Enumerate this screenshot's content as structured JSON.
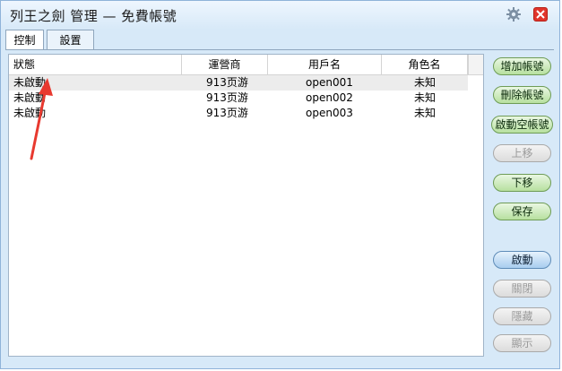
{
  "window": {
    "title": "列王之劍 管理 — 免費帳號"
  },
  "icons": {
    "settings": "gear-icon",
    "close": "close-icon"
  },
  "tabs": [
    {
      "label": "控制"
    },
    {
      "label": "設置"
    }
  ],
  "table": {
    "columns": [
      "狀態",
      "運營商",
      "用戶名",
      "角色名"
    ],
    "rows": [
      {
        "status": "未啟動",
        "operator": "913页游",
        "username": "open001",
        "role": "未知"
      },
      {
        "status": "未啟動",
        "operator": "913页游",
        "username": "open002",
        "role": "未知"
      },
      {
        "status": "未啟動",
        "operator": "913页游",
        "username": "open003",
        "role": "未知"
      }
    ]
  },
  "buttons": {
    "add_account": "增加帳號",
    "delete_account": "刪除帳號",
    "start_empty_account": "啟動空帳號",
    "move_up": "上移",
    "move_down": "下移",
    "save": "保存",
    "start": "啟動",
    "close": "關閉",
    "hide": "隱藏",
    "show": "顯示"
  },
  "annotation": {
    "color": "#e8392f"
  }
}
